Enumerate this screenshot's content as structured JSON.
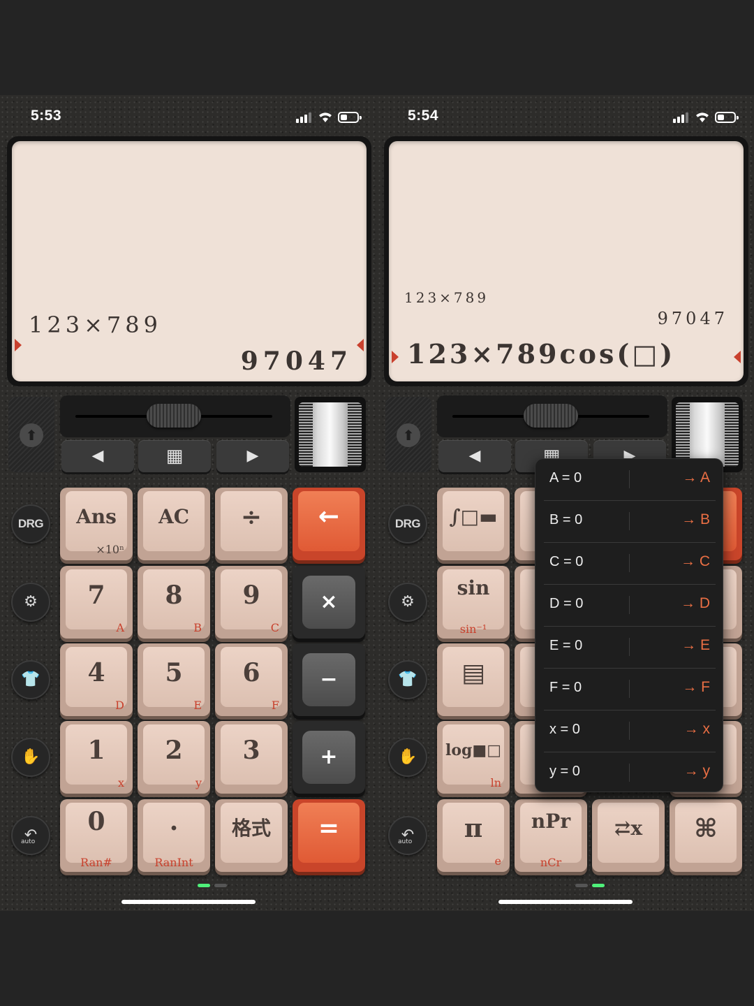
{
  "left": {
    "status_time": "5:53",
    "display": {
      "expression": "123×789",
      "result": "97047"
    },
    "nav": {
      "left": "◀",
      "grid": "▦",
      "right": "▶"
    },
    "side": {
      "drg": "DRG",
      "auto": "auto"
    },
    "keys": [
      {
        "main": "Ans",
        "sub": "×10ⁿ",
        "style": "beige"
      },
      {
        "main": "AC",
        "sub": "",
        "style": "beige"
      },
      {
        "main": "÷",
        "sub": "",
        "style": "beige"
      },
      {
        "main": "←",
        "sub": "",
        "style": "orange"
      },
      {
        "main": "7",
        "sub": "A",
        "style": "beige"
      },
      {
        "main": "8",
        "sub": "B",
        "style": "beige"
      },
      {
        "main": "9",
        "sub": "C",
        "style": "beige"
      },
      {
        "main": "×",
        "sub": "",
        "style": "dark"
      },
      {
        "main": "4",
        "sub": "D",
        "style": "beige"
      },
      {
        "main": "5",
        "sub": "E",
        "style": "beige"
      },
      {
        "main": "6",
        "sub": "F",
        "style": "beige"
      },
      {
        "main": "−",
        "sub": "",
        "style": "dark"
      },
      {
        "main": "1",
        "sub": "x",
        "style": "beige"
      },
      {
        "main": "2",
        "sub": "y",
        "style": "beige"
      },
      {
        "main": "3",
        "sub": "",
        "style": "beige"
      },
      {
        "main": "+",
        "sub": "",
        "style": "dark"
      },
      {
        "main": "0",
        "sub": "Ran#",
        "style": "beige"
      },
      {
        "main": ".",
        "sub": "RanInt",
        "style": "beige"
      },
      {
        "main": "格式",
        "sub": "",
        "style": "beige"
      },
      {
        "main": "=",
        "sub": "",
        "style": "orange"
      }
    ]
  },
  "right": {
    "status_time": "5:54",
    "display": {
      "history_expression": "123×789",
      "history_result": "97047",
      "input": "123×789cos(□)"
    },
    "nav": {
      "left": "◀",
      "grid": "▦",
      "right": "▶"
    },
    "side": {
      "drg": "DRG",
      "auto": "auto"
    },
    "keys": [
      {
        "main": "∫□▬",
        "sub": "",
        "style": "beige"
      },
      {
        "main": "sin",
        "sub": "sin⁻¹",
        "style": "beige"
      },
      {
        "main": "▤",
        "sub": "",
        "style": "beige"
      },
      {
        "main": "log■□",
        "sub": "ln",
        "style": "beige"
      },
      {
        "main": "π",
        "sub": "e",
        "style": "beige"
      },
      {
        "main": "nPr",
        "sub": "nCr",
        "style": "beige"
      },
      {
        "main": "⇄x",
        "sub": "",
        "style": "beige"
      },
      {
        "main": "⌘",
        "sub": "",
        "style": "beige"
      }
    ],
    "variables_popup": [
      {
        "label": "A = 0",
        "store": "→ A"
      },
      {
        "label": "B = 0",
        "store": "→ B"
      },
      {
        "label": "C = 0",
        "store": "→ C"
      },
      {
        "label": "D = 0",
        "store": "→ D"
      },
      {
        "label": "E = 0",
        "store": "→ E"
      },
      {
        "label": "F = 0",
        "store": "→ F"
      },
      {
        "label": "x = 0",
        "store": "→ x"
      },
      {
        "label": "y = 0",
        "store": "→ y"
      }
    ]
  },
  "colors": {
    "accent_orange": "#e05a35",
    "key_beige": "#dcc0b1",
    "display_bg": "#efe1d7",
    "label_red": "#c8412d"
  }
}
